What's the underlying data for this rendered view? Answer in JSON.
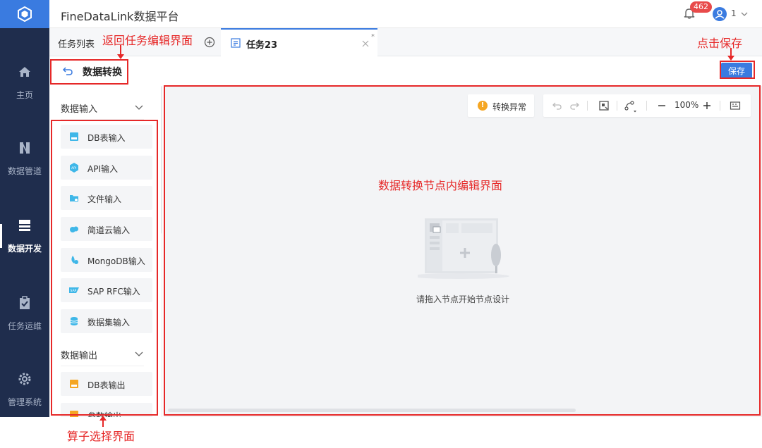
{
  "nav": {
    "items": [
      {
        "label": "主页",
        "icon": "home-icon"
      },
      {
        "label": "数据管道",
        "icon": "pipeline-icon"
      },
      {
        "label": "数据开发",
        "icon": "dev-icon",
        "active": true
      },
      {
        "label": "任务运维",
        "icon": "clipboard-check-icon"
      },
      {
        "label": "管理系统",
        "icon": "gear-icon"
      }
    ]
  },
  "header": {
    "title": "FineDataLink数据平台",
    "badge_count": "462",
    "user_label": "1"
  },
  "tabs": {
    "list_label": "任务列表",
    "active_label": "任务23",
    "modified_mark": "*"
  },
  "breadcrumb": {
    "title": "数据转换",
    "save_label": "保存"
  },
  "operators": {
    "input_group": "数据输入",
    "input_items": [
      "DB表输入",
      "API输入",
      "文件输入",
      "简道云输入",
      "MongoDB输入",
      "SAP RFC输入",
      "数据集输入"
    ],
    "output_group": "数据输出",
    "output_items": [
      "DB表输出",
      "参数输出"
    ]
  },
  "canvas": {
    "warning_label": "转换异常",
    "zoom": "100%",
    "empty_hint": "请拖入节点开始节点设计"
  },
  "annotations": {
    "back_hint": "返回任务编辑界面",
    "save_hint": "点击保存",
    "canvas_hint": "数据转换节点内编辑界面",
    "operator_hint": "算子选择界面"
  },
  "colors": {
    "accent": "#3a7be0",
    "nav_bg": "#1f2d4d",
    "annotation": "#e62828",
    "warning": "#f5a623"
  }
}
